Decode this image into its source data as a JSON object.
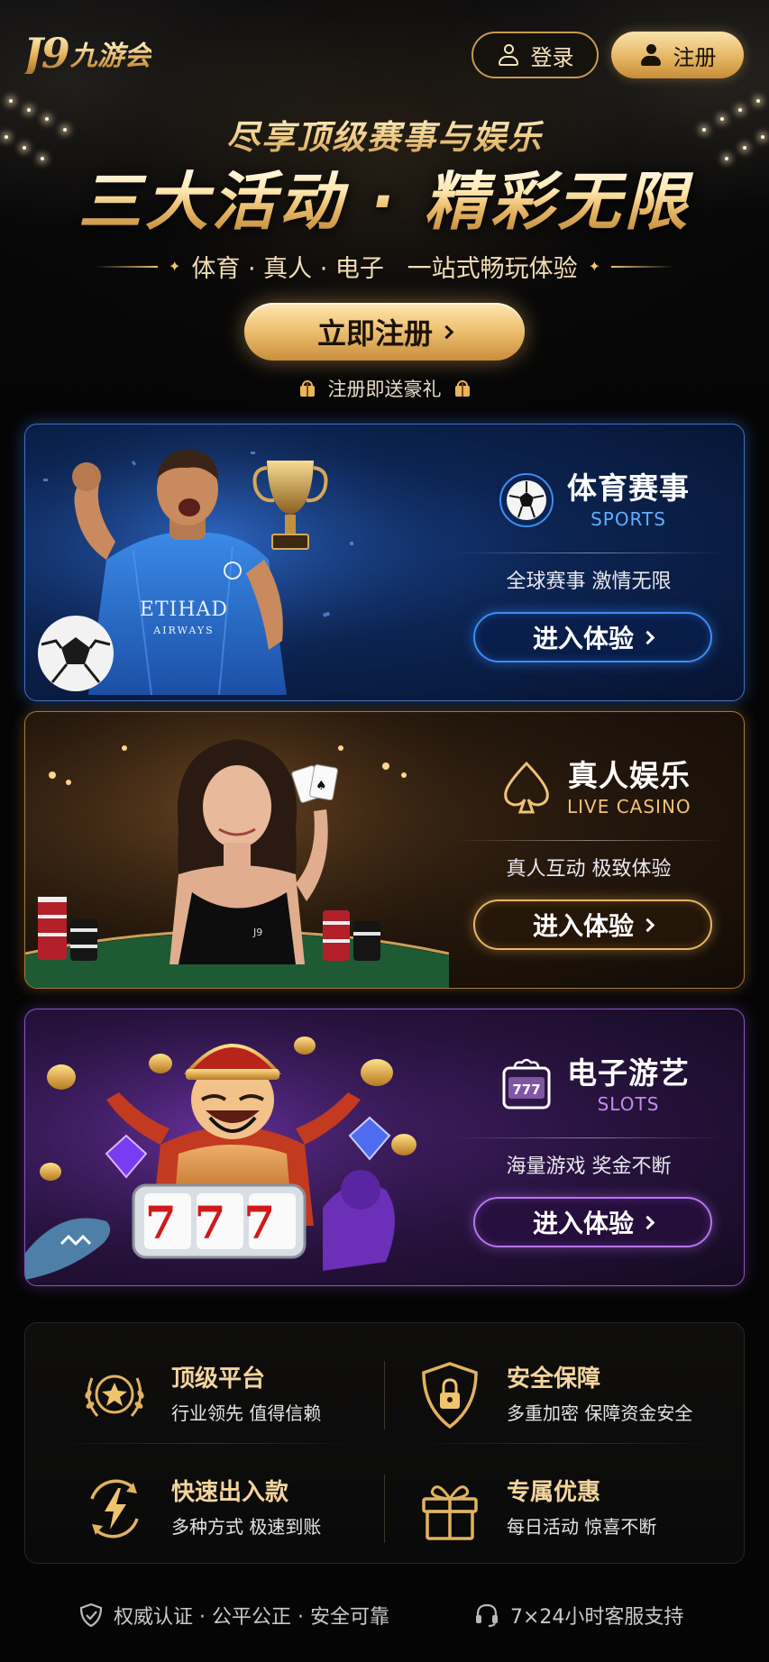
{
  "header": {
    "logo_mark": "J9",
    "logo_text": "九游会",
    "login_label": "登录",
    "register_label": "注册"
  },
  "hero": {
    "subtitle": "尽享顶级赛事与娱乐",
    "title": "三大活动 · 精彩无限",
    "tagline": "体育 · 真人 · 电子   一站式畅玩体验",
    "cta_label": "立即注册",
    "gift_note": "注册即送豪礼"
  },
  "cards": [
    {
      "title": "体育赛事",
      "subtitle": "SPORTS",
      "desc": "全球赛事 激情无限",
      "button": "进入体验",
      "icon": "soccer-ball-icon",
      "accent": "#3d8df5"
    },
    {
      "title": "真人娱乐",
      "subtitle": "LIVE CASINO",
      "desc": "真人互动 极致体验",
      "button": "进入体验",
      "icon": "spade-icon",
      "accent": "#e6b566"
    },
    {
      "title": "电子游艺",
      "subtitle": "SLOTS",
      "desc": "海量游戏 奖金不断",
      "button": "进入体验",
      "icon": "slot-machine-icon",
      "accent": "#b775f0"
    }
  ],
  "art": {
    "jersey_text_1": "ETIHAD",
    "jersey_text_2": "AIRWAYS",
    "dealer_badge": "J9",
    "reels": "777"
  },
  "features": [
    {
      "title": "顶级平台",
      "sub": "行业领先 值得信赖",
      "icon": "laurel-star-icon"
    },
    {
      "title": "安全保障",
      "sub": "多重加密 保障资金安全",
      "icon": "shield-lock-icon"
    },
    {
      "title": "快速出入款",
      "sub": "多种方式 极速到账",
      "icon": "lightning-icon"
    },
    {
      "title": "专属优惠",
      "sub": "每日活动 惊喜不断",
      "icon": "gift-icon"
    }
  ],
  "footer": {
    "left": "权威认证 · 公平公正 · 安全可靠",
    "right": "7×24小时客服支持"
  },
  "colors": {
    "gold": "#e2b25f",
    "sports_blue": "#3d8df5",
    "live_gold": "#e6b566",
    "slots_purple": "#b775f0",
    "background": "#050506"
  }
}
